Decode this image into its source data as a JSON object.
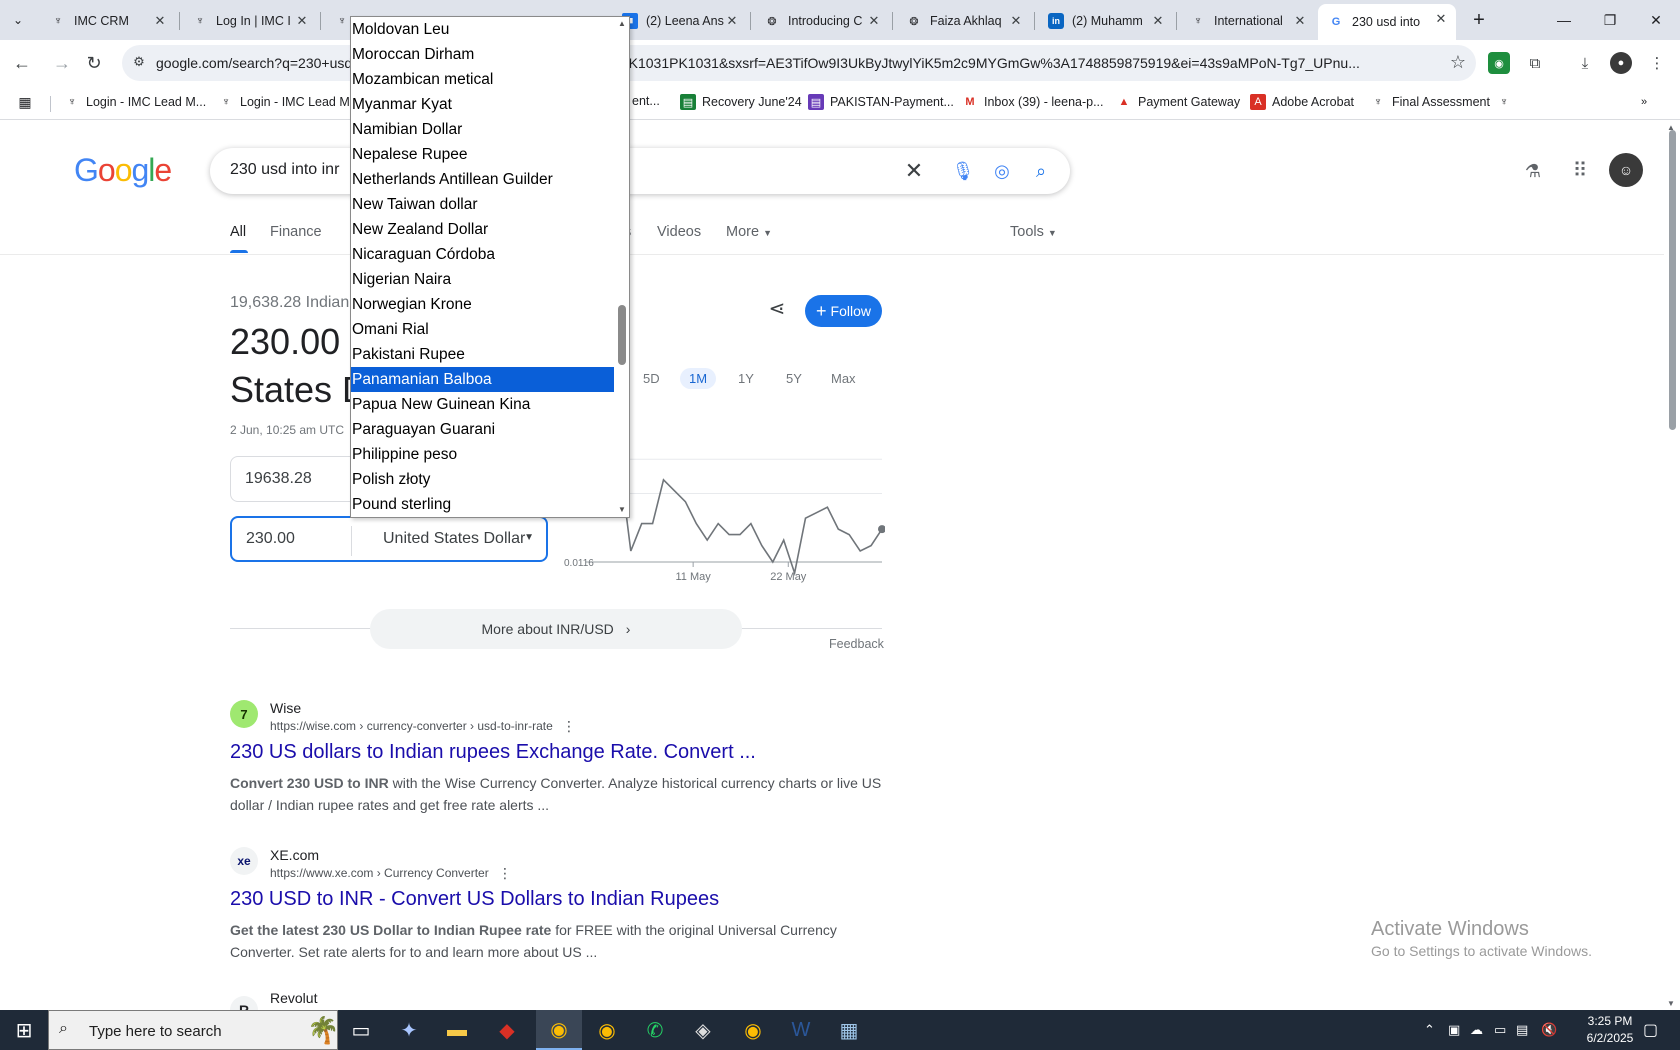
{
  "browser": {
    "tabs": [
      {
        "label": "IMC CRM",
        "icon": "imc-icon"
      },
      {
        "label": "Log In | IMC I",
        "icon": "imc-icon"
      },
      {
        "label": "",
        "icon": "imc-icon"
      },
      {
        "label": "(2) Leena Ans",
        "icon": "doc-icon"
      },
      {
        "label": "Introducing C",
        "icon": "openai-icon"
      },
      {
        "label": "Faiza Akhlaq",
        "icon": "openai-icon"
      },
      {
        "label": "(2) Muhamm",
        "icon": "linkedin-icon"
      },
      {
        "label": "International",
        "icon": "imc-icon"
      },
      {
        "label": "230 usd into",
        "icon": "google-icon"
      }
    ],
    "url": "google.com/search?q=230+usd",
    "url_tail": "1C1YTUH_enPK1031PK1031&sxsrf=AE3TifOw9I3UkByJtwylYiK5m2c9MYGmGw%3A1748859875919&ei=43s9aMPoN-Tg7_UPnu...",
    "bookmarks": [
      {
        "label": "Login - IMC Lead M..."
      },
      {
        "label": "Login - IMC Lead M..."
      },
      {
        "label": "ent..."
      },
      {
        "label": "Recovery June'24"
      },
      {
        "label": "PAKISTAN-Payment..."
      },
      {
        "label": "Inbox (39) - leena-p..."
      },
      {
        "label": "Payment Gateway"
      },
      {
        "label": "Adobe Acrobat"
      },
      {
        "label": "Final Assessment"
      }
    ]
  },
  "google": {
    "logo": "Google",
    "query": "230 usd into inr",
    "tabs": [
      "All",
      "Finance",
      "s",
      "Videos",
      "More",
      "Tools"
    ]
  },
  "converter": {
    "result_sub": "19,638.28 Indian",
    "result_big_1": "230.00",
    "result_big_2": "States D",
    "timestamp": "2 Jun, 10:25 am UTC",
    "top_value": "19638.28",
    "bottom_value": "230.00",
    "bottom_currency": "United States Dollar",
    "ranges": [
      "5D",
      "1M",
      "1Y",
      "5Y",
      "Max"
    ],
    "active_range": "1M",
    "follow_label": "Follow",
    "more_about": "More about INR/USD",
    "feedback": "Feedback"
  },
  "chart_data": {
    "type": "line",
    "series": [
      {
        "values": [
          0.0118,
          0.01165,
          0.01173,
          0.01157,
          0.01162,
          0.01162,
          0.0117,
          0.01168,
          0.01166,
          0.01162,
          0.01159,
          0.01162,
          0.0116,
          0.0116,
          0.01162,
          0.01158,
          0.01155,
          0.01159,
          0.01153,
          0.01163,
          0.01164,
          0.01165,
          0.01161,
          0.0116,
          0.01157,
          0.01158,
          0.01161
        ]
      }
    ],
    "x_ticks": [
      "11 May",
      "22 May"
    ],
    "y_ticks": [
      "0.0116"
    ],
    "ylim": [
      0.01155,
      0.0118
    ]
  },
  "dropdown": {
    "items": [
      "Moldovan Leu",
      "Moroccan Dirham",
      "Mozambican metical",
      "Myanmar Kyat",
      "Namibian Dollar",
      "Nepalese Rupee",
      "Netherlands Antillean Guilder",
      "New Taiwan dollar",
      "New Zealand Dollar",
      "Nicaraguan Córdoba",
      "Nigerian Naira",
      "Norwegian Krone",
      "Omani Rial",
      "Pakistani Rupee",
      "Panamanian Balboa",
      "Papua New Guinean Kina",
      "Paraguayan Guarani",
      "Philippine peso",
      "Polish złoty",
      "Pound sterling"
    ],
    "selected": "Panamanian Balboa"
  },
  "results": [
    {
      "site": "Wise",
      "url": "https://wise.com › currency-converter › usd-to-inr-rate",
      "title": "230 US dollars to Indian rupees Exchange Rate. Convert ...",
      "snippet_bold": "Convert 230 USD to INR",
      "snippet": " with the Wise Currency Converter. Analyze historical currency charts or live US dollar / Indian rupee rates and get free rate alerts ..."
    },
    {
      "site": "XE.com",
      "url": "https://www.xe.com › Currency Converter",
      "title": "230 USD to INR - Convert US Dollars to Indian Rupees",
      "snippet_bold": "Get the latest 230 US Dollar to Indian Rupee rate",
      "snippet": " for FREE with the original Universal Currency Converter. Set rate alerts for to and learn more about US ..."
    },
    {
      "site": "Revolut",
      "url": "",
      "title": "",
      "snippet_bold": "",
      "snippet": ""
    }
  ],
  "watermark": {
    "line1": "Activate Windows",
    "line2": "Go to Settings to activate Windows."
  },
  "taskbar": {
    "search_placeholder": "Type here to search",
    "time": "3:25 PM",
    "date": "6/2/2025"
  }
}
